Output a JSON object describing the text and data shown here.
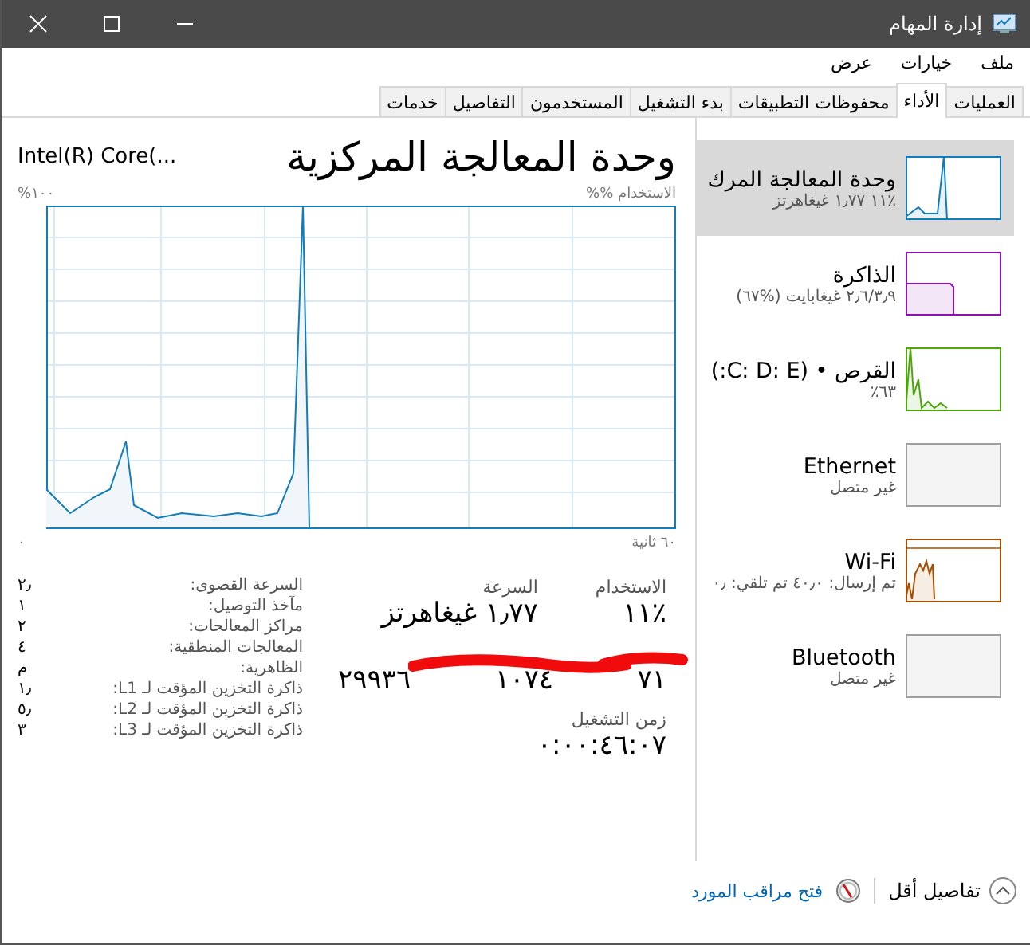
{
  "window": {
    "title": "إدارة المهام"
  },
  "menu": [
    "ملف",
    "خيارات",
    "عرض"
  ],
  "tabs": [
    {
      "label": "العمليات",
      "selected": false
    },
    {
      "label": "الأداء",
      "selected": true
    },
    {
      "label": "محفوظات التطبيقات",
      "selected": false
    },
    {
      "label": "بدء التشغيل",
      "selected": false
    },
    {
      "label": "المستخدمون",
      "selected": false
    },
    {
      "label": "التفاصيل",
      "selected": false
    },
    {
      "label": "خدمات",
      "selected": false
    }
  ],
  "sidebar": {
    "items": [
      {
        "kind": "cpu",
        "name": "وحدة المعالجة المرك",
        "detail": "٪١١  ١٫٧٧ غيغاهرتز",
        "color": "#117dbb",
        "selected": true
      },
      {
        "kind": "memory",
        "name": "الذاكرة",
        "detail": "٢٫٦/٣٫٩ غيغابايت (%٦٧)",
        "color": "#8b12ae",
        "selected": false
      },
      {
        "kind": "disk",
        "name": "القرص • (C: D: E:)",
        "detail": "٦٣٪",
        "color": "#4da60c",
        "selected": false
      },
      {
        "kind": "disconnected",
        "name": "Ethernet",
        "detail": "غير متصل",
        "color": "#a0a0a0",
        "selected": false
      },
      {
        "kind": "wifi",
        "name": "Wi-Fi",
        "detail": "تم إرسال: ٤٠٫٠  تم تلقي: ٠٫",
        "color": "#a74f01",
        "selected": false
      },
      {
        "kind": "disconnected",
        "name": "Bluetooth",
        "detail": "غير متصل",
        "color": "#a0a0a0",
        "selected": false
      }
    ]
  },
  "header": {
    "title": "وحدة المعالجة المركزية",
    "model": "Intel(R) Core(..."
  },
  "graph": {
    "label": "الاستخدام %%",
    "max": "١٠٠%",
    "span": "٦٠ ثانية",
    "min": "٠"
  },
  "stats": {
    "usage_label": "الاستخدام",
    "usage": "٪١١",
    "speed_label": "السرعة",
    "speed": "١٫٧٧ غيغاهرتز",
    "counts": [
      "٧١",
      "١٠٧٤",
      "٢٩٩٣٦"
    ],
    "uptime_label": "زمن التشغيل",
    "uptime": "٠:٠٠:٤٦:٠٧"
  },
  "specs": [
    {
      "label": "السرعة القصوى:",
      "value": "٢٫"
    },
    {
      "label": "مآخذ التوصيل:",
      "value": "١"
    },
    {
      "label": "مراكز المعالجات:",
      "value": "٢"
    },
    {
      "label": "المعالجات المنطقية:",
      "value": "٤"
    },
    {
      "label": "الظاهرية:",
      "value": "م"
    },
    {
      "label": "ذاكرة التخزين المؤقت لـ L1:",
      "value": "١٫"
    },
    {
      "label": "ذاكرة التخزين المؤقت لـ L2:",
      "value": "٥٫"
    },
    {
      "label": "ذاكرة التخزين المؤقت لـ L3:",
      "value": "٣"
    }
  ],
  "footer": {
    "less": "تفاصيل أقل",
    "monitor": "فتح مراقب المورد"
  }
}
